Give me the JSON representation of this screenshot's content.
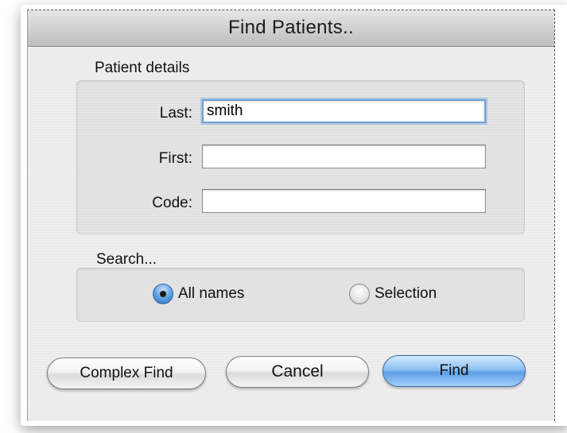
{
  "dialog": {
    "title": "Find Patients.."
  },
  "patient_details": {
    "label": "Patient details",
    "fields": {
      "last": {
        "label": "Last:",
        "value": "smith"
      },
      "first": {
        "label": "First:",
        "value": ""
      },
      "code": {
        "label": "Code:",
        "value": ""
      }
    }
  },
  "search": {
    "label": "Search...",
    "options": {
      "all_names": {
        "label": "All names",
        "selected": true
      },
      "selection": {
        "label": "Selection",
        "selected": false
      }
    }
  },
  "buttons": {
    "complex_find": "Complex Find",
    "cancel": "Cancel",
    "find": "Find"
  },
  "colors": {
    "focus_ring": "#6ea2d8",
    "default_button": "#5c9ee6",
    "window_bg": "#ececec"
  }
}
